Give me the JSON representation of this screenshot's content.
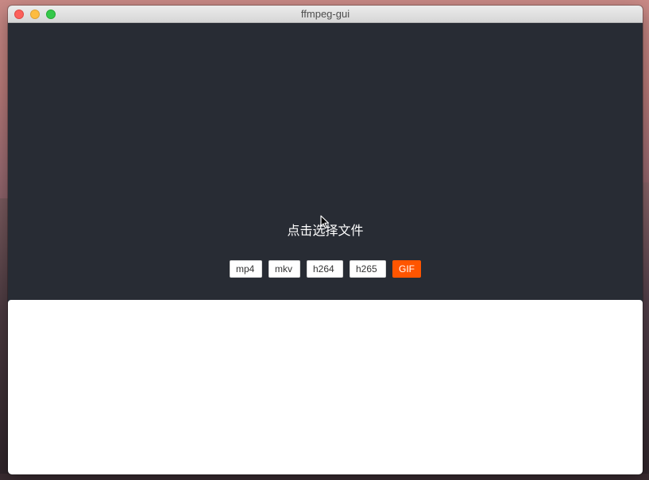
{
  "window": {
    "title": "ffmpeg-gui"
  },
  "drop_area": {
    "select_file_text": "点击选择文件"
  },
  "format_buttons": [
    {
      "label": "mp4",
      "active": false
    },
    {
      "label": "mkv",
      "active": false
    },
    {
      "label": "h264",
      "active": false
    },
    {
      "label": "h265",
      "active": false
    },
    {
      "label": "GIF",
      "active": true
    }
  ],
  "colors": {
    "app_background": "#282c34",
    "accent_active": "#ff5500",
    "output_panel": "#ffffff",
    "close": "#fc605b",
    "minimize": "#fdbc40",
    "maximize": "#34c84a"
  },
  "icons": {
    "cursor": "mouse-pointer-icon"
  }
}
